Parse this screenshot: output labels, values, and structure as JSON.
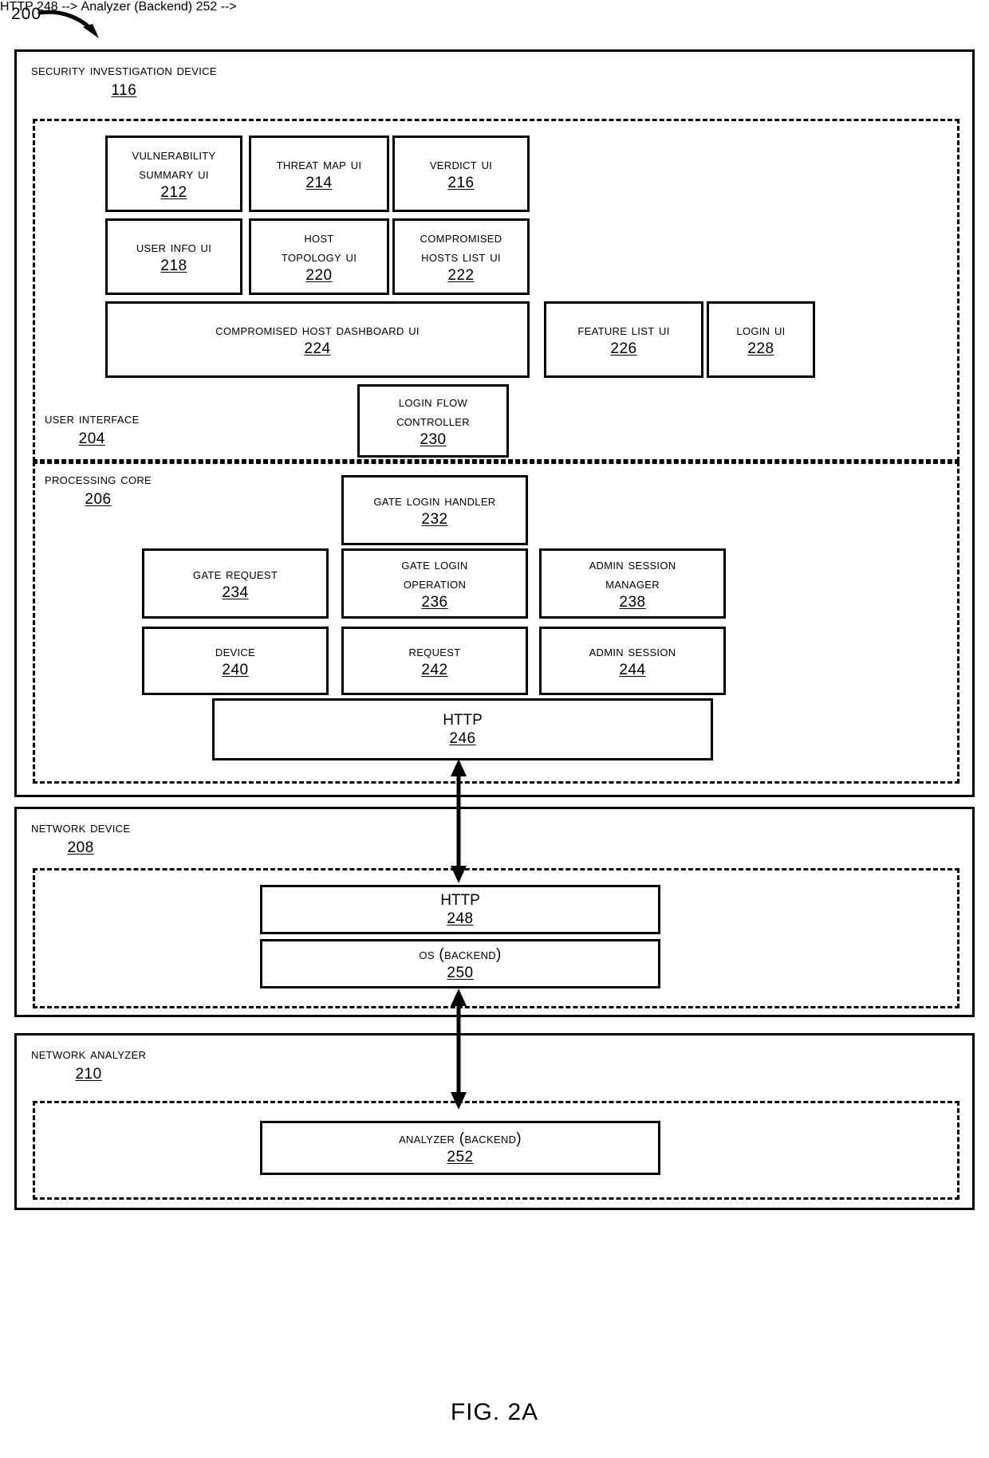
{
  "figure": {
    "number": "200",
    "caption": "FIG. 2A"
  },
  "security_investigation_device": {
    "title": "Security Investigation Device",
    "ref": "116",
    "user_interface": {
      "title": "User Interface",
      "ref": "204",
      "boxes": [
        {
          "label": "Vulnerability\nSummary UI",
          "ref": "212"
        },
        {
          "label": "Threat Map UI",
          "ref": "214"
        },
        {
          "label": "Verdict UI",
          "ref": "216"
        },
        {
          "label": "User Info UI",
          "ref": "218"
        },
        {
          "label": "Host\nTopology UI",
          "ref": "220"
        },
        {
          "label": "Compromised\nHosts List UI",
          "ref": "222"
        },
        {
          "label": "Compromised Host Dashboard UI",
          "ref": "224"
        },
        {
          "label": "Feature List UI",
          "ref": "226"
        },
        {
          "label": "Login UI",
          "ref": "228"
        },
        {
          "label": "Login Flow\nController",
          "ref": "230"
        }
      ]
    },
    "processing_core": {
      "title": "Processing Core",
      "ref": "206",
      "boxes": [
        {
          "label": "Gate Login Handler",
          "ref": "232"
        },
        {
          "label": "Gate Request",
          "ref": "234"
        },
        {
          "label": "Gate Login\nOperation",
          "ref": "236"
        },
        {
          "label": "Admin Session\nManager",
          "ref": "238"
        },
        {
          "label": "Device",
          "ref": "240"
        },
        {
          "label": "Request",
          "ref": "242"
        },
        {
          "label": "Admin Session",
          "ref": "244"
        },
        {
          "label": "HTTP",
          "ref": "246"
        }
      ]
    }
  },
  "network_device": {
    "title": "Network Device",
    "ref": "208",
    "boxes": [
      {
        "label": "HTTP",
        "ref": "248"
      },
      {
        "label": "OS (Backend)",
        "ref": "250"
      }
    ]
  },
  "network_analyzer": {
    "title": "Network Analyzer",
    "ref": "210",
    "boxes": [
      {
        "label": "Analyzer (Backend)",
        "ref": "252"
      }
    ]
  },
  "connectors": [
    {
      "name": "http-246-to-http-248",
      "type": "double-arrow-vertical"
    },
    {
      "name": "os-250-to-analyzer-252",
      "type": "double-arrow-vertical"
    }
  ]
}
